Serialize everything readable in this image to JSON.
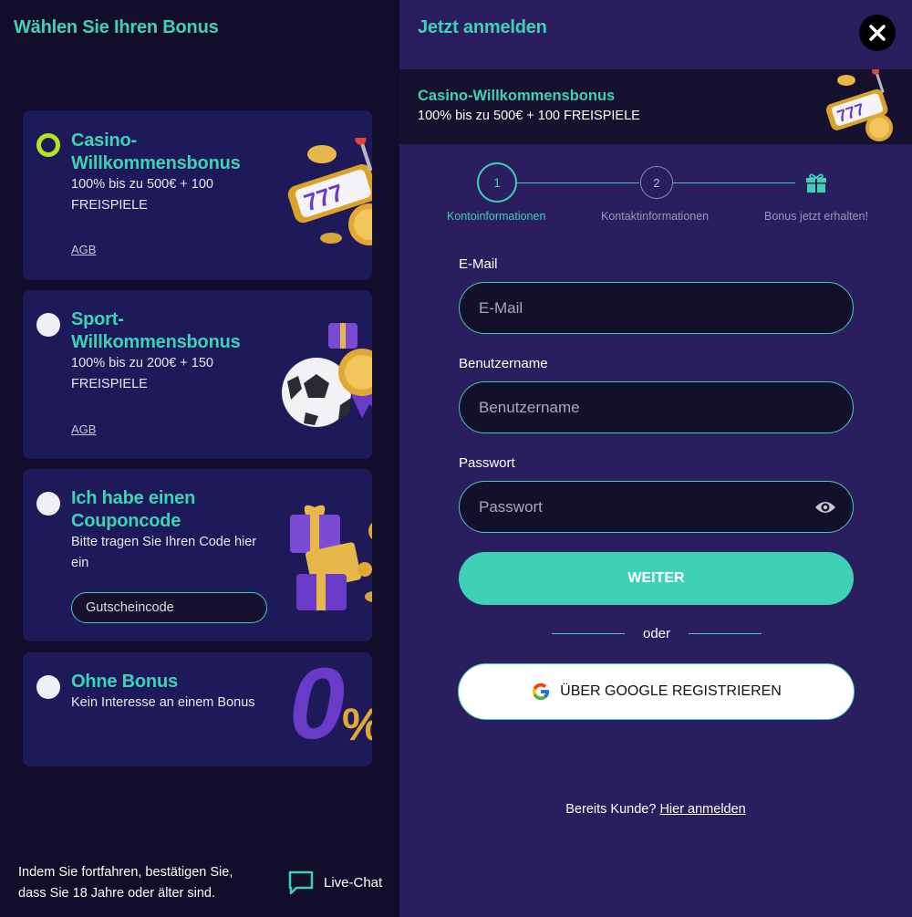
{
  "left": {
    "title": "Wählen Sie Ihren Bonus",
    "cards": [
      {
        "title_line1": "Casino-",
        "title_line2": "Willkommensbonus",
        "desc_line1": "100% bis zu 500€ + 100",
        "desc_line2": "FREISPIELE",
        "link": "AGB",
        "selected": true
      },
      {
        "title_line1": "Sport-",
        "title_line2": "Willkommensbonus",
        "desc_line1": "100% bis zu 200€ + 150",
        "desc_line2": "FREISPIELE",
        "link": "AGB",
        "selected": false
      },
      {
        "title_line1": "Ich habe einen",
        "title_line2": "Couponcode",
        "desc_line1": "Bitte tragen Sie Ihren Code hier",
        "desc_line2": "ein",
        "coupon_placeholder": "Gutscheincode",
        "selected": false
      },
      {
        "title_line1": "Ohne Bonus",
        "desc_line1": "Kein Interesse an einem Bonus",
        "art_text": "0%",
        "selected": false
      }
    ],
    "consent_line1": "Indem Sie fortfahren, bestätigen Sie,",
    "consent_line2": "dass Sie 18 Jahre oder älter sind.",
    "livechat_label": "Live-Chat",
    "livechat_icon": "chat-bubble-icon"
  },
  "right": {
    "title": "Jetzt anmelden",
    "close_icon": "close-icon",
    "bonus_title": "Casino-Willkommensbonus",
    "bonus_sub": "100% bis zu 500€ + 100 FREISPIELE",
    "steps": [
      {
        "number": "1",
        "label": "Kontoinformationen",
        "active": true
      },
      {
        "number": "2",
        "label": "Kontaktinformationen",
        "active": false
      },
      {
        "icon": "gift-icon",
        "label": "Bonus jetzt erhalten!",
        "active": false
      }
    ],
    "email_label": "E-Mail",
    "email_placeholder": "E-Mail",
    "username_label": "Benutzername",
    "username_placeholder": "Benutzername",
    "password_label": "Passwort",
    "password_placeholder": "Passwort",
    "submit_label": "WEITER",
    "or_label": "oder",
    "google_label": "ÜBER GOOGLE REGISTRIEREN",
    "login_prompt": "Bereits Kunde?",
    "login_link": "Hier anmelden"
  },
  "colors": {
    "accent": "#3fd1b5",
    "radio_selected": "#b5e61d",
    "card_bg": "#1e1a5a",
    "panel_bg": "#2a1e5e"
  }
}
